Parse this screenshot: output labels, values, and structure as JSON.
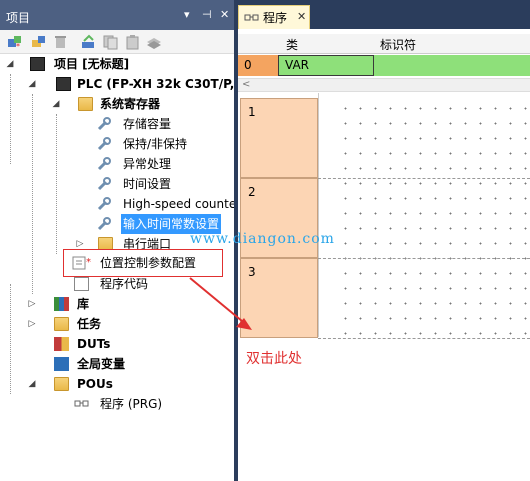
{
  "left_panel": {
    "title": "项目",
    "controls": [
      "▾",
      "⊣",
      "✕"
    ]
  },
  "tree": {
    "project": "项目 [无标题]",
    "plc": "PLC (FP-XH 32k C30T/P,C",
    "sys_reg": "系统寄存器",
    "sys_items": [
      "存储容量",
      "保持/非保持",
      "异常处理",
      "时间设置",
      "High-speed counte",
      "输入时间常数设置",
      "串行端口"
    ],
    "pos_ctrl": "位置控制参数配置",
    "program_code": "程序代码",
    "lib": "库",
    "tasks": "任务",
    "duts": "DUTs",
    "global_vars": "全局变量",
    "pous": "POUs",
    "program": "程序 (PRG)"
  },
  "editor": {
    "tab_label": "程序",
    "tab_close": "✕",
    "col_class": "类",
    "col_identifier": "标识符",
    "var_row_num": "0",
    "var_row_type": "VAR",
    "rungs": [
      "1",
      "2",
      "3"
    ]
  },
  "overlay": {
    "watermark": "www.diangon.com",
    "annotation": "双击此处",
    "accent": "#e03030"
  }
}
